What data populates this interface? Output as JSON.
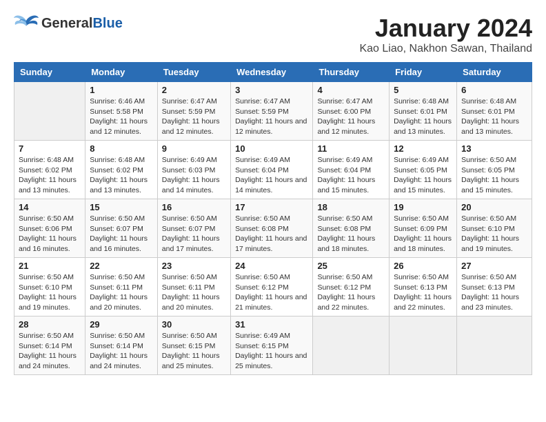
{
  "header": {
    "logo_general": "General",
    "logo_blue": "Blue",
    "title": "January 2024",
    "subtitle": "Kao Liao, Nakhon Sawan, Thailand"
  },
  "days_of_week": [
    "Sunday",
    "Monday",
    "Tuesday",
    "Wednesday",
    "Thursday",
    "Friday",
    "Saturday"
  ],
  "weeks": [
    [
      {
        "day": null,
        "info": null
      },
      {
        "day": "1",
        "info": "Sunrise: 6:46 AM\nSunset: 5:58 PM\nDaylight: 11 hours and 12 minutes."
      },
      {
        "day": "2",
        "info": "Sunrise: 6:47 AM\nSunset: 5:59 PM\nDaylight: 11 hours and 12 minutes."
      },
      {
        "day": "3",
        "info": "Sunrise: 6:47 AM\nSunset: 5:59 PM\nDaylight: 11 hours and 12 minutes."
      },
      {
        "day": "4",
        "info": "Sunrise: 6:47 AM\nSunset: 6:00 PM\nDaylight: 11 hours and 12 minutes."
      },
      {
        "day": "5",
        "info": "Sunrise: 6:48 AM\nSunset: 6:01 PM\nDaylight: 11 hours and 13 minutes."
      },
      {
        "day": "6",
        "info": "Sunrise: 6:48 AM\nSunset: 6:01 PM\nDaylight: 11 hours and 13 minutes."
      }
    ],
    [
      {
        "day": "7",
        "info": "Sunrise: 6:48 AM\nSunset: 6:02 PM\nDaylight: 11 hours and 13 minutes."
      },
      {
        "day": "8",
        "info": "Sunrise: 6:48 AM\nSunset: 6:02 PM\nDaylight: 11 hours and 13 minutes."
      },
      {
        "day": "9",
        "info": "Sunrise: 6:49 AM\nSunset: 6:03 PM\nDaylight: 11 hours and 14 minutes."
      },
      {
        "day": "10",
        "info": "Sunrise: 6:49 AM\nSunset: 6:04 PM\nDaylight: 11 hours and 14 minutes."
      },
      {
        "day": "11",
        "info": "Sunrise: 6:49 AM\nSunset: 6:04 PM\nDaylight: 11 hours and 15 minutes."
      },
      {
        "day": "12",
        "info": "Sunrise: 6:49 AM\nSunset: 6:05 PM\nDaylight: 11 hours and 15 minutes."
      },
      {
        "day": "13",
        "info": "Sunrise: 6:50 AM\nSunset: 6:05 PM\nDaylight: 11 hours and 15 minutes."
      }
    ],
    [
      {
        "day": "14",
        "info": "Sunrise: 6:50 AM\nSunset: 6:06 PM\nDaylight: 11 hours and 16 minutes."
      },
      {
        "day": "15",
        "info": "Sunrise: 6:50 AM\nSunset: 6:07 PM\nDaylight: 11 hours and 16 minutes."
      },
      {
        "day": "16",
        "info": "Sunrise: 6:50 AM\nSunset: 6:07 PM\nDaylight: 11 hours and 17 minutes."
      },
      {
        "day": "17",
        "info": "Sunrise: 6:50 AM\nSunset: 6:08 PM\nDaylight: 11 hours and 17 minutes."
      },
      {
        "day": "18",
        "info": "Sunrise: 6:50 AM\nSunset: 6:08 PM\nDaylight: 11 hours and 18 minutes."
      },
      {
        "day": "19",
        "info": "Sunrise: 6:50 AM\nSunset: 6:09 PM\nDaylight: 11 hours and 18 minutes."
      },
      {
        "day": "20",
        "info": "Sunrise: 6:50 AM\nSunset: 6:10 PM\nDaylight: 11 hours and 19 minutes."
      }
    ],
    [
      {
        "day": "21",
        "info": "Sunrise: 6:50 AM\nSunset: 6:10 PM\nDaylight: 11 hours and 19 minutes."
      },
      {
        "day": "22",
        "info": "Sunrise: 6:50 AM\nSunset: 6:11 PM\nDaylight: 11 hours and 20 minutes."
      },
      {
        "day": "23",
        "info": "Sunrise: 6:50 AM\nSunset: 6:11 PM\nDaylight: 11 hours and 20 minutes."
      },
      {
        "day": "24",
        "info": "Sunrise: 6:50 AM\nSunset: 6:12 PM\nDaylight: 11 hours and 21 minutes."
      },
      {
        "day": "25",
        "info": "Sunrise: 6:50 AM\nSunset: 6:12 PM\nDaylight: 11 hours and 22 minutes."
      },
      {
        "day": "26",
        "info": "Sunrise: 6:50 AM\nSunset: 6:13 PM\nDaylight: 11 hours and 22 minutes."
      },
      {
        "day": "27",
        "info": "Sunrise: 6:50 AM\nSunset: 6:13 PM\nDaylight: 11 hours and 23 minutes."
      }
    ],
    [
      {
        "day": "28",
        "info": "Sunrise: 6:50 AM\nSunset: 6:14 PM\nDaylight: 11 hours and 24 minutes."
      },
      {
        "day": "29",
        "info": "Sunrise: 6:50 AM\nSunset: 6:14 PM\nDaylight: 11 hours and 24 minutes."
      },
      {
        "day": "30",
        "info": "Sunrise: 6:50 AM\nSunset: 6:15 PM\nDaylight: 11 hours and 25 minutes."
      },
      {
        "day": "31",
        "info": "Sunrise: 6:49 AM\nSunset: 6:15 PM\nDaylight: 11 hours and 25 minutes."
      },
      {
        "day": null,
        "info": null
      },
      {
        "day": null,
        "info": null
      },
      {
        "day": null,
        "info": null
      }
    ]
  ]
}
